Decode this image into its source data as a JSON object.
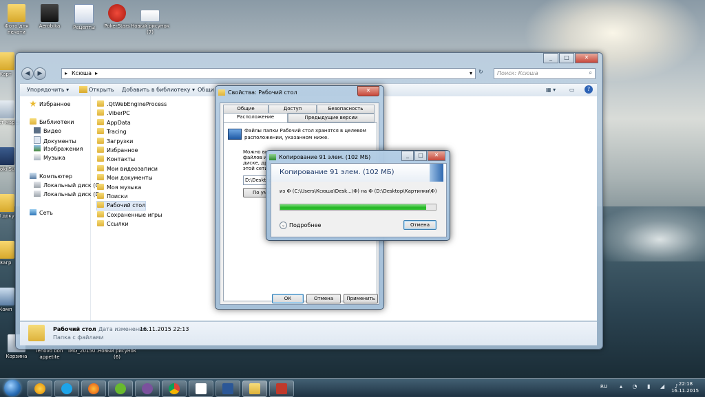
{
  "desktop": {
    "icons_top": [
      {
        "label": "Фото для печати"
      },
      {
        "label": "Aerobika"
      },
      {
        "label": "Рецепты"
      },
      {
        "label": "PokerStars"
      },
      {
        "label": "Новый рисунок (7)"
      }
    ],
    "icons_left": [
      {
        "label": "Карт"
      },
      {
        "label": "Наст марш"
      },
      {
        "label": "Noki Su"
      },
      {
        "label": "М доку"
      },
      {
        "label": "Загр"
      },
      {
        "label": "Комп"
      }
    ],
    "icons_bottom": [
      {
        "label": "Корзина"
      },
      {
        "label": "lenovo bon appetite"
      },
      {
        "label": "IMG_20150..."
      },
      {
        "label": "Новый рисунок (6)"
      }
    ]
  },
  "explorer": {
    "address": "Ксюша",
    "search_placeholder": "Поиск: Ксюша",
    "toolbar": [
      "Упорядочить",
      "Открыть",
      "Добавить в библиотеку",
      "Общи"
    ],
    "nav": [
      {
        "label": "Избранное",
        "indent": 0
      },
      {
        "label": "Библиотеки",
        "indent": 0
      },
      {
        "label": "Видео",
        "indent": 1
      },
      {
        "label": "Документы",
        "indent": 1
      },
      {
        "label": "Изображения",
        "indent": 1
      },
      {
        "label": "Музыка",
        "indent": 1
      },
      {
        "label": "Компьютер",
        "indent": 0
      },
      {
        "label": "Локальный диск (C",
        "indent": 1
      },
      {
        "label": "Локальный диск (D",
        "indent": 1
      },
      {
        "label": "Сеть",
        "indent": 0
      }
    ],
    "files": [
      ".QtWebEngineProcess",
      ".ViberPC",
      "AppData",
      "Tracing",
      "Загрузки",
      "Избранное",
      "Контакты",
      "Мои видеозаписи",
      "Мои документы",
      "Моя музыка",
      "Поиски",
      "Рабочий стол",
      "Сохраненные игры",
      "Ссылки"
    ],
    "selected_file": "Рабочий стол",
    "details": {
      "name": "Рабочий стол",
      "modified_label": "Дата изменения:",
      "modified": "16.11.2015 22:13",
      "type": "Папка с файлами"
    }
  },
  "properties": {
    "title": "Свойства: Рабочий стол",
    "tabs_row1": [
      "Общие",
      "Доступ",
      "Безопасность"
    ],
    "tabs_row2": [
      "Расположение",
      "Предыдущие версии"
    ],
    "description": "Файлы папки Рабочий стол хранятся в целевом расположении, указанном ниже.",
    "partial_lines": [
      "Можно вы",
      "файлов из",
      "диске, дру",
      "этой сети."
    ],
    "path": "D:\\Desktop",
    "button_default": "По умолч",
    "ok": "ОК",
    "cancel": "Отмена",
    "apply": "Применить"
  },
  "copy": {
    "title": "Копирование 91 элем. (102 МБ)",
    "heading": "Копирование 91 элем. (102 МБ)",
    "from_to": "из Ф (C:\\Users\\Ксюша\\Desk...\\Ф)  на Ф (D:\\Desktop\\Картинки\\Ф)",
    "progress": 0.94,
    "more": "Подробнее",
    "cancel": "Отмена"
  },
  "taskbar": {
    "lang": "RU",
    "time": "22:18",
    "date": "16.11.2015"
  }
}
